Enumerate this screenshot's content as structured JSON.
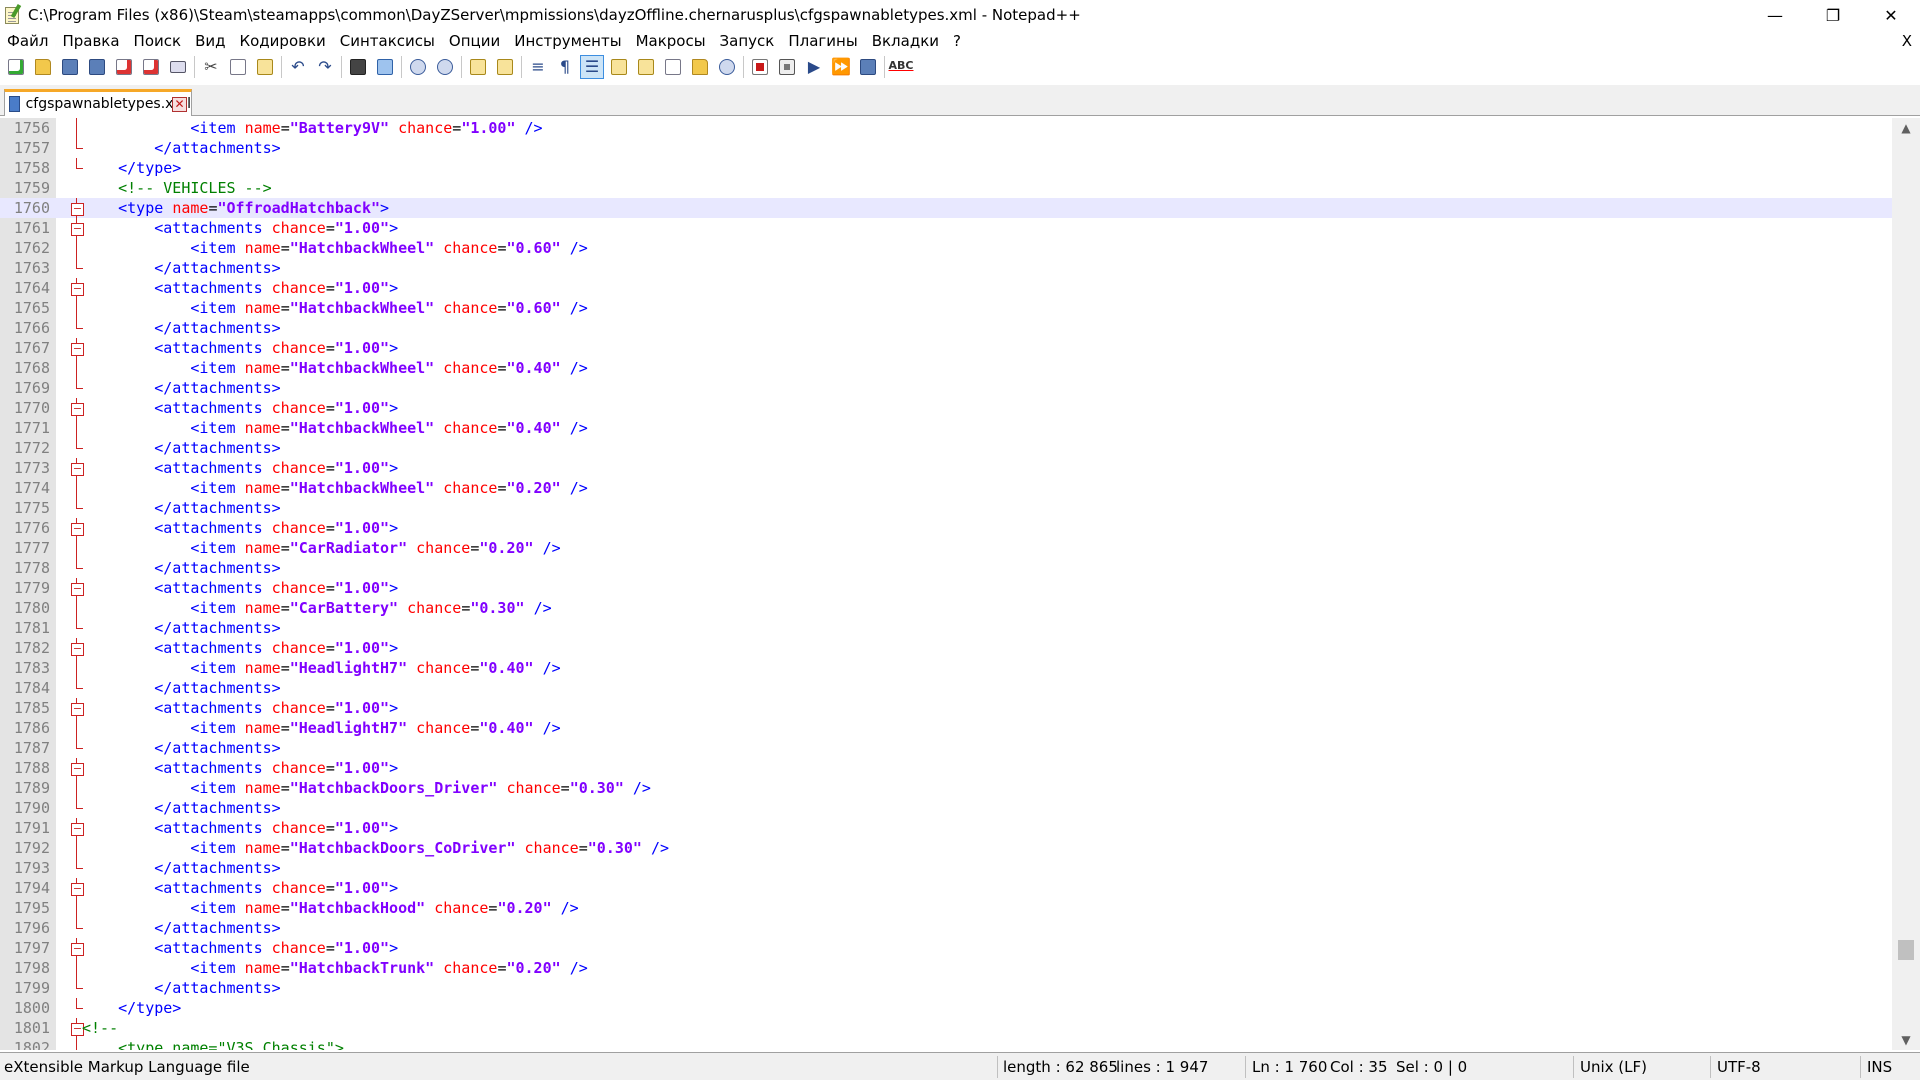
{
  "window": {
    "title": "C:\\Program Files (x86)\\Steam\\steamapps\\common\\DayZServer\\mpmissions\\dayzOffline.chernarusplus\\cfgspawnabletypes.xml - Notepad++",
    "minimize": "—",
    "maximize": "❐",
    "close": "✕"
  },
  "menu": {
    "items": [
      "Файл",
      "Правка",
      "Поиск",
      "Вид",
      "Кодировки",
      "Синтаксисы",
      "Опции",
      "Инструменты",
      "Макросы",
      "Запуск",
      "Плагины",
      "Вкладки",
      "?"
    ],
    "close": "X"
  },
  "toolbar": {
    "icons": [
      "new-file-icon",
      "open-file-icon",
      "save-icon",
      "save-all-icon",
      "close-file-icon",
      "close-all-icon",
      "print-icon",
      "cut-icon",
      "copy-icon",
      "paste-icon",
      "undo-icon",
      "redo-icon",
      "find-icon",
      "replace-icon",
      "zoom-in-icon",
      "zoom-out-icon",
      "sync-vertical-icon",
      "sync-horizontal-icon",
      "word-wrap-icon",
      "show-all-characters-icon",
      "indent-guide-icon",
      "user-defined-language-icon",
      "document-map-icon",
      "function-list-icon",
      "folder-workspace-icon",
      "monitoring-icon",
      "macro-record-icon",
      "macro-stop-icon",
      "macro-play-icon",
      "macro-run-multiple-icon",
      "macro-save-icon",
      "spell-check-icon"
    ],
    "spellcheck_label": "ABC"
  },
  "tab": {
    "label": "cfgspawnabletypes.xml",
    "close": "✕"
  },
  "editor": {
    "current_line": 1760,
    "lines": [
      {
        "n": "1756",
        "fold": "line",
        "indent": 3,
        "kind": "item",
        "name": "Battery9V",
        "chance": "1.00"
      },
      {
        "n": "1757",
        "fold": "end",
        "indent": 2,
        "kind": "close",
        "tag": "attachments"
      },
      {
        "n": "1758",
        "fold": "end",
        "indent": 1,
        "kind": "close",
        "tag": "type"
      },
      {
        "n": "1759",
        "fold": "none",
        "indent": 1,
        "kind": "comment",
        "text": "<!-- VEHICLES -->"
      },
      {
        "n": "1760",
        "fold": "box",
        "indent": 1,
        "kind": "type",
        "name": "OffroadHatchback"
      },
      {
        "n": "1761",
        "fold": "box",
        "indent": 2,
        "kind": "attachments",
        "chance": "1.00"
      },
      {
        "n": "1762",
        "fold": "line",
        "indent": 3,
        "kind": "item",
        "name": "HatchbackWheel",
        "chance": "0.60"
      },
      {
        "n": "1763",
        "fold": "end",
        "indent": 2,
        "kind": "close",
        "tag": "attachments"
      },
      {
        "n": "1764",
        "fold": "box",
        "indent": 2,
        "kind": "attachments",
        "chance": "1.00"
      },
      {
        "n": "1765",
        "fold": "line",
        "indent": 3,
        "kind": "item",
        "name": "HatchbackWheel",
        "chance": "0.60"
      },
      {
        "n": "1766",
        "fold": "end",
        "indent": 2,
        "kind": "close",
        "tag": "attachments"
      },
      {
        "n": "1767",
        "fold": "box",
        "indent": 2,
        "kind": "attachments",
        "chance": "1.00"
      },
      {
        "n": "1768",
        "fold": "line",
        "indent": 3,
        "kind": "item",
        "name": "HatchbackWheel",
        "chance": "0.40"
      },
      {
        "n": "1769",
        "fold": "end",
        "indent": 2,
        "kind": "close",
        "tag": "attachments"
      },
      {
        "n": "1770",
        "fold": "box",
        "indent": 2,
        "kind": "attachments",
        "chance": "1.00"
      },
      {
        "n": "1771",
        "fold": "line",
        "indent": 3,
        "kind": "item",
        "name": "HatchbackWheel",
        "chance": "0.40"
      },
      {
        "n": "1772",
        "fold": "end",
        "indent": 2,
        "kind": "close",
        "tag": "attachments"
      },
      {
        "n": "1773",
        "fold": "box",
        "indent": 2,
        "kind": "attachments",
        "chance": "1.00"
      },
      {
        "n": "1774",
        "fold": "line",
        "indent": 3,
        "kind": "item",
        "name": "HatchbackWheel",
        "chance": "0.20"
      },
      {
        "n": "1775",
        "fold": "end",
        "indent": 2,
        "kind": "close",
        "tag": "attachments"
      },
      {
        "n": "1776",
        "fold": "box",
        "indent": 2,
        "kind": "attachments",
        "chance": "1.00"
      },
      {
        "n": "1777",
        "fold": "line",
        "indent": 3,
        "kind": "item",
        "name": "CarRadiator",
        "chance": "0.20"
      },
      {
        "n": "1778",
        "fold": "end",
        "indent": 2,
        "kind": "close",
        "tag": "attachments"
      },
      {
        "n": "1779",
        "fold": "box",
        "indent": 2,
        "kind": "attachments",
        "chance": "1.00"
      },
      {
        "n": "1780",
        "fold": "line",
        "indent": 3,
        "kind": "item",
        "name": "CarBattery",
        "chance": "0.30"
      },
      {
        "n": "1781",
        "fold": "end",
        "indent": 2,
        "kind": "close",
        "tag": "attachments"
      },
      {
        "n": "1782",
        "fold": "box",
        "indent": 2,
        "kind": "attachments",
        "chance": "1.00"
      },
      {
        "n": "1783",
        "fold": "line",
        "indent": 3,
        "kind": "item",
        "name": "HeadlightH7",
        "chance": "0.40"
      },
      {
        "n": "1784",
        "fold": "end",
        "indent": 2,
        "kind": "close",
        "tag": "attachments"
      },
      {
        "n": "1785",
        "fold": "box",
        "indent": 2,
        "kind": "attachments",
        "chance": "1.00"
      },
      {
        "n": "1786",
        "fold": "line",
        "indent": 3,
        "kind": "item",
        "name": "HeadlightH7",
        "chance": "0.40"
      },
      {
        "n": "1787",
        "fold": "end",
        "indent": 2,
        "kind": "close",
        "tag": "attachments"
      },
      {
        "n": "1788",
        "fold": "box",
        "indent": 2,
        "kind": "attachments",
        "chance": "1.00"
      },
      {
        "n": "1789",
        "fold": "line",
        "indent": 3,
        "kind": "item",
        "name": "HatchbackDoors_Driver",
        "chance": "0.30"
      },
      {
        "n": "1790",
        "fold": "end",
        "indent": 2,
        "kind": "close",
        "tag": "attachments"
      },
      {
        "n": "1791",
        "fold": "box",
        "indent": 2,
        "kind": "attachments",
        "chance": "1.00"
      },
      {
        "n": "1792",
        "fold": "line",
        "indent": 3,
        "kind": "item",
        "name": "HatchbackDoors_CoDriver",
        "chance": "0.30"
      },
      {
        "n": "1793",
        "fold": "end",
        "indent": 2,
        "kind": "close",
        "tag": "attachments"
      },
      {
        "n": "1794",
        "fold": "box",
        "indent": 2,
        "kind": "attachments",
        "chance": "1.00"
      },
      {
        "n": "1795",
        "fold": "line",
        "indent": 3,
        "kind": "item",
        "name": "HatchbackHood",
        "chance": "0.20"
      },
      {
        "n": "1796",
        "fold": "end",
        "indent": 2,
        "kind": "close",
        "tag": "attachments"
      },
      {
        "n": "1797",
        "fold": "box",
        "indent": 2,
        "kind": "attachments",
        "chance": "1.00"
      },
      {
        "n": "1798",
        "fold": "line",
        "indent": 3,
        "kind": "item",
        "name": "HatchbackTrunk",
        "chance": "0.20"
      },
      {
        "n": "1799",
        "fold": "end",
        "indent": 2,
        "kind": "close",
        "tag": "attachments"
      },
      {
        "n": "1800",
        "fold": "end",
        "indent": 1,
        "kind": "close",
        "tag": "type"
      },
      {
        "n": "1801",
        "fold": "box",
        "indent": 0,
        "kind": "comment",
        "text": "<!--"
      },
      {
        "n": "1802",
        "fold": "line",
        "indent": 1,
        "kind": "comment",
        "text": "<type name=\"V3S_Chassis\">"
      }
    ]
  },
  "statusbar": {
    "filetype": "eXtensible Markup Language file",
    "length": "length : 62 865",
    "lines": "lines : 1 947",
    "ln": "Ln : 1 760",
    "col": "Col : 35",
    "sel": "Sel : 0 | 0",
    "eol": "Unix (LF)",
    "encoding": "UTF-8",
    "mode": "INS"
  },
  "colors": {
    "tag": "#0000ff",
    "attribute": "#ff0000",
    "value": "#8000ff",
    "comment": "#008000",
    "current_line": "#e8e8ff",
    "tab_accent": "#f6a828"
  }
}
